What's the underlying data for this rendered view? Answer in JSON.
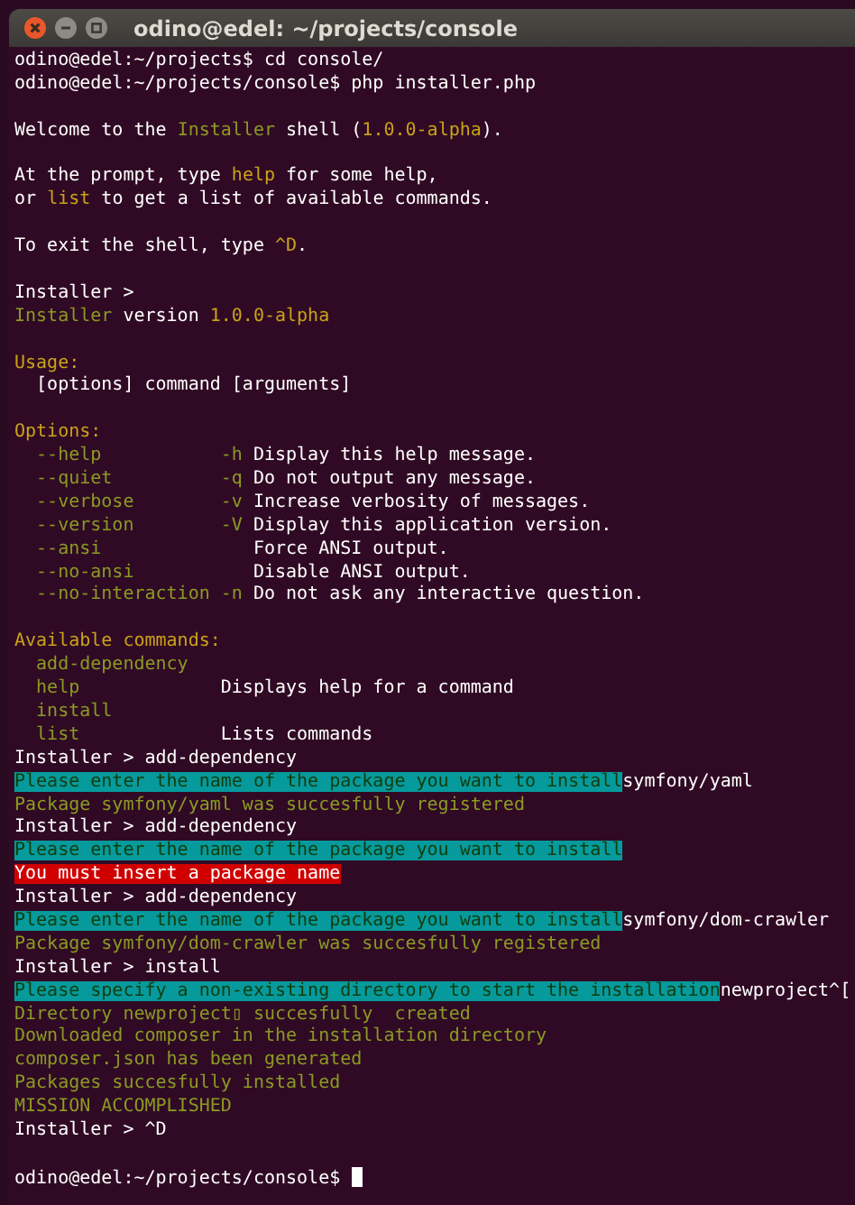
{
  "window": {
    "title": "odino@edel: ~/projects/console"
  },
  "terminal": {
    "lines": [
      {
        "kind": "text",
        "segments": [
          {
            "kind": "text",
            "text": "odino@edel:~/projects$ cd console/"
          }
        ]
      },
      {
        "kind": "text",
        "segments": [
          {
            "kind": "text",
            "text": "odino@edel:~/projects/console$ php installer.php"
          }
        ]
      },
      {
        "kind": "blank"
      },
      {
        "kind": "text",
        "segments": [
          {
            "kind": "text",
            "text": "Welcome to the "
          },
          {
            "kind": "name",
            "text": "Installer"
          },
          {
            "kind": "text",
            "text": " shell ("
          },
          {
            "kind": "keyword",
            "text": "1.0.0-alpha"
          },
          {
            "kind": "text",
            "text": ")."
          }
        ]
      },
      {
        "kind": "blank"
      },
      {
        "kind": "text",
        "segments": [
          {
            "kind": "text",
            "text": "At the prompt, type "
          },
          {
            "kind": "keyword",
            "text": "help"
          },
          {
            "kind": "text",
            "text": " for some help,"
          }
        ]
      },
      {
        "kind": "text",
        "segments": [
          {
            "kind": "text",
            "text": "or "
          },
          {
            "kind": "keyword",
            "text": "list"
          },
          {
            "kind": "text",
            "text": " to get a list of available commands."
          }
        ]
      },
      {
        "kind": "blank"
      },
      {
        "kind": "text",
        "segments": [
          {
            "kind": "text",
            "text": "To exit the shell, type "
          },
          {
            "kind": "keyword",
            "text": "^D"
          },
          {
            "kind": "text",
            "text": "."
          }
        ]
      },
      {
        "kind": "blank"
      },
      {
        "kind": "text",
        "segments": [
          {
            "kind": "text",
            "text": "Installer >"
          }
        ]
      },
      {
        "kind": "text",
        "segments": [
          {
            "kind": "name",
            "text": "Installer"
          },
          {
            "kind": "text",
            "text": " version "
          },
          {
            "kind": "keyword",
            "text": "1.0.0-alpha"
          }
        ]
      },
      {
        "kind": "blank"
      },
      {
        "kind": "text",
        "segments": [
          {
            "kind": "keyword",
            "text": "Usage:"
          }
        ]
      },
      {
        "kind": "text",
        "segments": [
          {
            "kind": "text",
            "text": "  [options] command [arguments]"
          }
        ]
      },
      {
        "kind": "blank"
      },
      {
        "kind": "text",
        "segments": [
          {
            "kind": "keyword",
            "text": "Options:"
          }
        ]
      },
      {
        "kind": "text",
        "segments": [
          {
            "kind": "name",
            "text": "  --help           -h"
          },
          {
            "kind": "text",
            "text": " Display this help message."
          }
        ]
      },
      {
        "kind": "text",
        "segments": [
          {
            "kind": "name",
            "text": "  --quiet          -q"
          },
          {
            "kind": "text",
            "text": " Do not output any message."
          }
        ]
      },
      {
        "kind": "text",
        "segments": [
          {
            "kind": "name",
            "text": "  --verbose        -v"
          },
          {
            "kind": "text",
            "text": " Increase verbosity of messages."
          }
        ]
      },
      {
        "kind": "text",
        "segments": [
          {
            "kind": "name",
            "text": "  --version        -V"
          },
          {
            "kind": "text",
            "text": " Display this application version."
          }
        ]
      },
      {
        "kind": "text",
        "segments": [
          {
            "kind": "name",
            "text": "  --ansi"
          },
          {
            "kind": "text",
            "text": "              Force ANSI output."
          }
        ]
      },
      {
        "kind": "text",
        "segments": [
          {
            "kind": "name",
            "text": "  --no-ansi"
          },
          {
            "kind": "text",
            "text": "           Disable ANSI output."
          }
        ]
      },
      {
        "kind": "text",
        "segments": [
          {
            "kind": "name",
            "text": "  --no-interaction -n"
          },
          {
            "kind": "text",
            "text": " Do not ask any interactive question."
          }
        ]
      },
      {
        "kind": "blank"
      },
      {
        "kind": "text",
        "segments": [
          {
            "kind": "keyword",
            "text": "Available commands:"
          }
        ]
      },
      {
        "kind": "text",
        "segments": [
          {
            "kind": "name",
            "text": "  add-dependency"
          }
        ]
      },
      {
        "kind": "text",
        "segments": [
          {
            "kind": "name",
            "text": "  help"
          },
          {
            "kind": "text",
            "text": "             Displays help for a command"
          }
        ]
      },
      {
        "kind": "text",
        "segments": [
          {
            "kind": "name",
            "text": "  install"
          }
        ]
      },
      {
        "kind": "text",
        "segments": [
          {
            "kind": "name",
            "text": "  list"
          },
          {
            "kind": "text",
            "text": "             Lists commands"
          }
        ]
      },
      {
        "kind": "text",
        "segments": [
          {
            "kind": "text",
            "text": "Installer > add-dependency"
          }
        ]
      },
      {
        "kind": "text",
        "segments": [
          {
            "kind": "question",
            "text": "Please enter the name of the package you want to install"
          },
          {
            "kind": "text",
            "text": "symfony/yaml"
          }
        ]
      },
      {
        "kind": "text",
        "segments": [
          {
            "kind": "name",
            "text": "Package symfony/yaml was succesfully registered"
          }
        ]
      },
      {
        "kind": "text",
        "segments": [
          {
            "kind": "text",
            "text": "Installer > add-dependency"
          }
        ]
      },
      {
        "kind": "text",
        "segments": [
          {
            "kind": "question",
            "text": "Please enter the name of the package you want to install"
          }
        ]
      },
      {
        "kind": "text",
        "segments": [
          {
            "kind": "error",
            "text": "You must insert a package name"
          }
        ]
      },
      {
        "kind": "text",
        "segments": [
          {
            "kind": "text",
            "text": "Installer > add-dependency"
          }
        ]
      },
      {
        "kind": "text",
        "segments": [
          {
            "kind": "question",
            "text": "Please enter the name of the package you want to install"
          },
          {
            "kind": "text",
            "text": "symfony/dom-crawler"
          }
        ]
      },
      {
        "kind": "text",
        "segments": [
          {
            "kind": "name",
            "text": "Package symfony/dom-crawler was succesfully registered"
          }
        ]
      },
      {
        "kind": "text",
        "segments": [
          {
            "kind": "text",
            "text": "Installer > install"
          }
        ]
      },
      {
        "kind": "text",
        "segments": [
          {
            "kind": "question",
            "text": "Please specify a non-existing directory to start the installation"
          },
          {
            "kind": "text",
            "text": "newproject^["
          }
        ]
      },
      {
        "kind": "text",
        "segments": [
          {
            "kind": "name",
            "text": "Directory newproject▯ succesfully  created"
          }
        ]
      },
      {
        "kind": "text",
        "segments": [
          {
            "kind": "name",
            "text": "Downloaded composer in the installation directory"
          }
        ]
      },
      {
        "kind": "text",
        "segments": [
          {
            "kind": "name",
            "text": "composer.json has been generated"
          }
        ]
      },
      {
        "kind": "text",
        "segments": [
          {
            "kind": "name",
            "text": "Packages succesfully installed"
          }
        ]
      },
      {
        "kind": "text",
        "segments": [
          {
            "kind": "name",
            "text": "MISSION ACCOMPLISHED"
          }
        ]
      },
      {
        "kind": "text",
        "segments": [
          {
            "kind": "text",
            "text": "Installer > ^D"
          }
        ]
      },
      {
        "kind": "blank"
      },
      {
        "kind": "text",
        "segments": [
          {
            "kind": "text",
            "text": "odino@edel:~/projects/console$ "
          }
        ]
      }
    ],
    "cursor": {
      "visible": true
    }
  }
}
